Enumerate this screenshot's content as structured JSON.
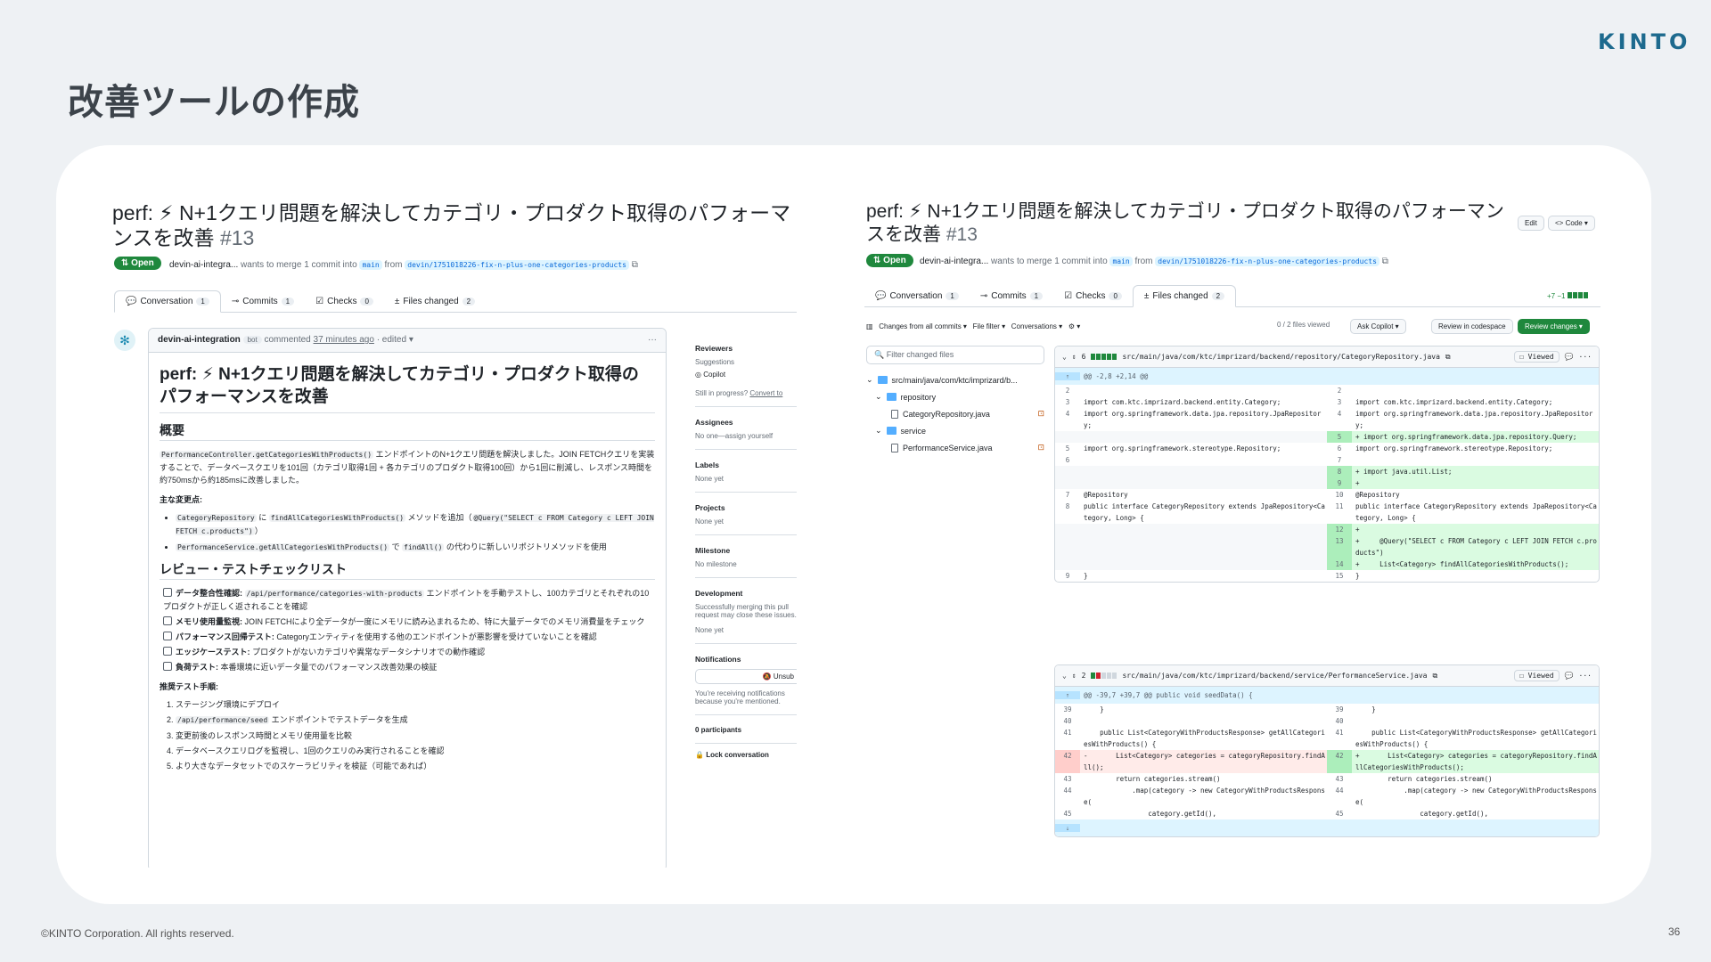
{
  "slide": {
    "logo": "KINTO",
    "title": "改善ツールの作成",
    "copyright": "©KINTO Corporation. All rights reserved.",
    "page_number": "36"
  },
  "left": {
    "pr_title": "perf: ⚡ N+1クエリ問題を解決してカテゴリ・プロダクト取得のパフォーマンスを改善",
    "pr_number": "#13",
    "status": "Open",
    "author": "devin-ai-integra...",
    "meta_text": "wants to merge 1 commit into",
    "base_branch": "main",
    "from_text": "from",
    "head_branch": "devin/1751018226-fix-n-plus-one-categories-products",
    "tabs": [
      {
        "label": "Conversation",
        "count": "1"
      },
      {
        "label": "Commits",
        "count": "1"
      },
      {
        "label": "Checks",
        "count": "0"
      },
      {
        "label": "Files changed",
        "count": "2"
      }
    ],
    "comment_author": "devin-ai-integration",
    "bot_label": "bot",
    "comment_meta": "commented",
    "comment_time": "37 minutes ago",
    "edited": "· edited ▾",
    "body_title": "perf: ⚡ N+1クエリ問題を解決してカテゴリ・プロダクト取得のパフォーマンスを改善",
    "overview_heading": "概要",
    "overview_code": "PerformanceController.getCategoriesWithProducts()",
    "overview_text": " エンドポイントのN+1クエリ問題を解決しました。JOIN FETCHクエリを実装することで、データベースクエリを101回（カテゴリ取得1回 + 各カテゴリのプロダクト取得100回）から1回に削減し、レスポンス時間を約750msから約185msに改善しました。",
    "changes_heading": "主な変更点:",
    "change1_code": "CategoryRepository",
    "change1_text1": " に ",
    "change1_code2": "findAllCategoriesWithProducts()",
    "change1_text2": " メソッドを追加（",
    "change1_code3": "@Query(\"SELECT c FROM Category c LEFT JOIN FETCH c.products\")",
    "change1_text3": "）",
    "change2_code": "PerformanceService.getAllCategoriesWithProducts()",
    "change2_text1": " で ",
    "change2_code2": "findAll()",
    "change2_text2": " の代わりに新しいリポジトリメソッドを使用",
    "checklist_heading": "レビュー・テストチェックリスト",
    "checklist": [
      {
        "bold": "データ整合性確認:",
        "code": "/api/performance/categories-with-products",
        "text": " エンドポイントを手動テストし、100カテゴリとそれぞれの10プロダクトが正しく返されることを確認"
      },
      {
        "bold": "メモリ使用量監視:",
        "code": "",
        "text": " JOIN FETCHにより全データが一度にメモリに読み込まれるため、特に大量データでのメモリ消費量をチェック"
      },
      {
        "bold": "パフォーマンス回帰テスト:",
        "code": "",
        "text": " Categoryエンティティを使用する他のエンドポイントが悪影響を受けていないことを確認"
      },
      {
        "bold": "エッジケーステスト:",
        "code": "",
        "text": " プロダクトがないカテゴリや異常なデータシナリオでの動作確認"
      },
      {
        "bold": "負荷テスト:",
        "code": "",
        "text": " 本番環境に近いデータ量でのパフォーマンス改善効果の検証"
      }
    ],
    "steps_heading": "推奨テスト手順:",
    "steps": [
      {
        "pre": "ステージング環境にデプロイ",
        "code": "",
        "post": ""
      },
      {
        "pre": "",
        "code": "/api/performance/seed",
        "post": " エンドポイントでテストデータを生成"
      },
      {
        "pre": "変更前後のレスポンス時間とメモリ使用量を比較",
        "code": "",
        "post": ""
      },
      {
        "pre": "データベースクエリログを監視し、1回のクエリのみ実行されることを確認",
        "code": "",
        "post": ""
      },
      {
        "pre": "より大きなデータセットでのスケーラビリティを検証（可能であれば）",
        "code": "",
        "post": ""
      }
    ],
    "sidebar": {
      "reviewers": "Reviewers",
      "suggestions": "Suggestions",
      "copilot": "Copilot",
      "still_in_progress": "Still in progress?",
      "convert": "Convert to",
      "assignees": "Assignees",
      "assignees_value": "No one—assign yourself",
      "labels": "Labels",
      "labels_value": "None yet",
      "projects": "Projects",
      "projects_value": "None yet",
      "milestone": "Milestone",
      "milestone_value": "No milestone",
      "development": "Development",
      "development_text": "Successfully merging this pull request may close these issues.",
      "development_value": "None yet",
      "notifications": "Notifications",
      "unsubscribe": "Unsub",
      "notif_text": "You're receiving notifications because you're mentioned.",
      "participants": "0 participants",
      "lock": "Lock conversation"
    }
  },
  "right": {
    "pr_title": "perf: ⚡ N+1クエリ問題を解決してカテゴリ・プロダクト取得のパフォーマンスを改善",
    "pr_number": "#13",
    "edit": "Edit",
    "code_btn": "<> Code ▾",
    "status": "Open",
    "author": "devin-ai-integra...",
    "meta_text": "wants to merge 1 commit into",
    "base_branch": "main",
    "from_text": "from",
    "head_branch": "devin/1751018226-fix-n-plus-one-categories-products",
    "tabs": [
      {
        "label": "Conversation",
        "count": "1"
      },
      {
        "label": "Commits",
        "count": "1"
      },
      {
        "label": "Checks",
        "count": "0"
      },
      {
        "label": "Files changed",
        "count": "2"
      }
    ],
    "diffstat": "+7 −1",
    "toolbar": {
      "changes_from": "Changes from all commits ▾",
      "file_filter": "File filter ▾",
      "conversations": "Conversations ▾",
      "settings": "⚙ ▾",
      "viewed": "0 / 2 files viewed",
      "ask_copilot": "Ask Copilot ▾",
      "review_codespace": "Review in codespace",
      "review_changes": "Review changes ▾"
    },
    "tree": {
      "filter_placeholder": "Filter changed files",
      "root": "src/main/java/com/ktc/imprizard/b...",
      "folders": [
        {
          "name": "repository",
          "file": "CategoryRepository.java"
        },
        {
          "name": "service",
          "file": "PerformanceService.java"
        }
      ]
    },
    "diff1": {
      "count": "6",
      "path": "src/main/java/com/ktc/imprizard/backend/repository/CategoryRepository.java",
      "viewed": "Viewed",
      "hunk": "@@ -2,8 +2,14 @@",
      "lines": [
        {
          "lt": "",
          "ln": "2",
          "lc": "",
          "rt": "",
          "rn": "2",
          "rc": ""
        },
        {
          "lt": "",
          "ln": "3",
          "lc": "import com.ktc.imprizard.backend.entity.Category;",
          "rt": "",
          "rn": "3",
          "rc": "import com.ktc.imprizard.backend.entity.Category;"
        },
        {
          "lt": "",
          "ln": "4",
          "lc": "import org.springframework.data.jpa.repository.JpaRepository;",
          "rt": "",
          "rn": "4",
          "rc": "import org.springframework.data.jpa.repository.JpaRepository;"
        },
        {
          "lt": "empty",
          "ln": "",
          "lc": "",
          "rt": "add",
          "rn": "5",
          "rc": "+ import org.springframework.data.jpa.repository.Query;"
        },
        {
          "lt": "",
          "ln": "5",
          "lc": "import org.springframework.stereotype.Repository;",
          "rt": "",
          "rn": "6",
          "rc": "import org.springframework.stereotype.Repository;"
        },
        {
          "lt": "",
          "ln": "6",
          "lc": "",
          "rt": "",
          "rn": "7",
          "rc": ""
        },
        {
          "lt": "empty",
          "ln": "",
          "lc": "",
          "rt": "add",
          "rn": "8",
          "rc": "+ import java.util.List;"
        },
        {
          "lt": "empty",
          "ln": "",
          "lc": "",
          "rt": "add",
          "rn": "9",
          "rc": "+"
        },
        {
          "lt": "",
          "ln": "7",
          "lc": "@Repository",
          "rt": "",
          "rn": "10",
          "rc": "@Repository"
        },
        {
          "lt": "",
          "ln": "8",
          "lc": "public interface CategoryRepository extends JpaRepository<Category, Long> {",
          "rt": "",
          "rn": "11",
          "rc": "public interface CategoryRepository extends JpaRepository<Category, Long> {"
        },
        {
          "lt": "empty",
          "ln": "",
          "lc": "",
          "rt": "add",
          "rn": "12",
          "rc": "+"
        },
        {
          "lt": "empty",
          "ln": "",
          "lc": "",
          "rt": "add",
          "rn": "13",
          "rc": "+     @Query(\"SELECT c FROM Category c LEFT JOIN FETCH c.products\")"
        },
        {
          "lt": "empty",
          "ln": "",
          "lc": "",
          "rt": "add",
          "rn": "14",
          "rc": "+     List<Category> findAllCategoriesWithProducts();"
        },
        {
          "lt": "",
          "ln": "9",
          "lc": "}",
          "rt": "",
          "rn": "15",
          "rc": "}"
        }
      ]
    },
    "diff2": {
      "count": "2",
      "path": "src/main/java/com/ktc/imprizard/backend/service/PerformanceService.java",
      "viewed": "Viewed",
      "hunk": "@@ -39,7 +39,7 @@ public void seedData() {",
      "lines": [
        {
          "lt": "",
          "ln": "39",
          "lc": "    }",
          "rt": "",
          "rn": "39",
          "rc": "    }"
        },
        {
          "lt": "",
          "ln": "40",
          "lc": "",
          "rt": "",
          "rn": "40",
          "rc": ""
        },
        {
          "lt": "",
          "ln": "41",
          "lc": "    public List<CategoryWithProductsResponse> getAllCategoriesWithProducts() {",
          "rt": "",
          "rn": "41",
          "rc": "    public List<CategoryWithProductsResponse> getAllCategoriesWithProducts() {"
        },
        {
          "lt": "del",
          "ln": "42",
          "lc": "-       List<Category> categories = categoryRepository.findAll();",
          "rt": "add",
          "rn": "42",
          "rc": "+       List<Category> categories = categoryRepository.findAllCategoriesWithProducts();"
        },
        {
          "lt": "",
          "ln": "43",
          "lc": "        return categories.stream()",
          "rt": "",
          "rn": "43",
          "rc": "        return categories.stream()"
        },
        {
          "lt": "",
          "ln": "44",
          "lc": "            .map(category -> new CategoryWithProductsResponse(",
          "rt": "",
          "rn": "44",
          "rc": "            .map(category -> new CategoryWithProductsResponse("
        },
        {
          "lt": "",
          "ln": "45",
          "lc": "                category.getId(),",
          "rt": "",
          "rn": "45",
          "rc": "                category.getId(),"
        }
      ]
    }
  }
}
